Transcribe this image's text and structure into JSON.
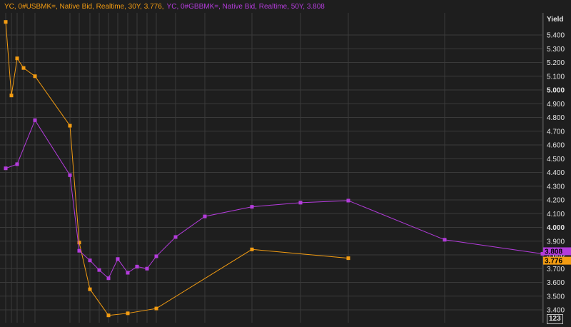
{
  "legend": {
    "series1": "YC, 0#USBMK=, Native Bid, Realtime, 30Y, 3.776,",
    "series2": "YC, 0#GBBMK=, Native Bid, Realtime, 50Y, 3.808"
  },
  "axis_badge": "123",
  "colors": {
    "background": "#1e1e1e",
    "grid": "#3a3a3a",
    "us": "#f39c12",
    "gb": "#b43cdc",
    "axis_text": "#e6e6e6"
  },
  "chart_data": {
    "type": "line",
    "title": "",
    "xlabel": "",
    "ylabel": "Yield",
    "ylim": [
      3.35,
      5.55
    ],
    "yticks": [
      3.4,
      3.5,
      3.6,
      3.7,
      3.8,
      3.9,
      4.0,
      4.1,
      4.2,
      4.3,
      4.4,
      4.5,
      4.6,
      4.7,
      4.8,
      4.9,
      5.0,
      5.1,
      5.2,
      5.3,
      5.4
    ],
    "ytick_labels": [
      "3.400",
      "3.500",
      "3.600",
      "3.700",
      "3.800",
      "3.900",
      "4.000",
      "4.100",
      "4.200",
      "4.300",
      "4.400",
      "4.500",
      "4.600",
      "4.700",
      "4.800",
      "4.900",
      "5.000",
      "5.100",
      "5.200",
      "5.300",
      "5.400"
    ],
    "bold_ticks": [
      "4.000",
      "5.000"
    ],
    "grid": true,
    "series": [
      {
        "name": "YC, 0#USBMK=, Native Bid, Realtime, 30Y",
        "last_value": "3.776",
        "color": "#f39c12",
        "points": [
          [
            0.08,
            5.495
          ],
          [
            0.25,
            4.96
          ],
          [
            0.5,
            5.23
          ],
          [
            0.75,
            5.16
          ],
          [
            1,
            5.1
          ],
          [
            2,
            4.74
          ],
          [
            3,
            3.89
          ],
          [
            5,
            3.55
          ],
          [
            7,
            3.36
          ],
          [
            10,
            3.375
          ],
          [
            20,
            3.41
          ],
          [
            30,
            3.84
          ],
          [
            50,
            3.776
          ]
        ]
      },
      {
        "name": "YC, 0#GBBMK=, Native Bid, Realtime, 50Y",
        "last_value": "3.808",
        "color": "#b43cdc",
        "points": [
          [
            0.08,
            4.43
          ],
          [
            0.5,
            4.46
          ],
          [
            1,
            4.78
          ],
          [
            2,
            4.38
          ],
          [
            3,
            3.83
          ],
          [
            4,
            3.76
          ],
          [
            5,
            3.69
          ],
          [
            6,
            3.63
          ],
          [
            7,
            3.77
          ],
          [
            8,
            3.67
          ],
          [
            9,
            3.715
          ],
          [
            10,
            3.7
          ],
          [
            12,
            3.79
          ],
          [
            15,
            3.93
          ],
          [
            20,
            4.08
          ],
          [
            25,
            4.15
          ],
          [
            30,
            4.18
          ],
          [
            40,
            4.195
          ],
          [
            50,
            3.91
          ],
          [
            60,
            3.808
          ]
        ]
      }
    ]
  }
}
